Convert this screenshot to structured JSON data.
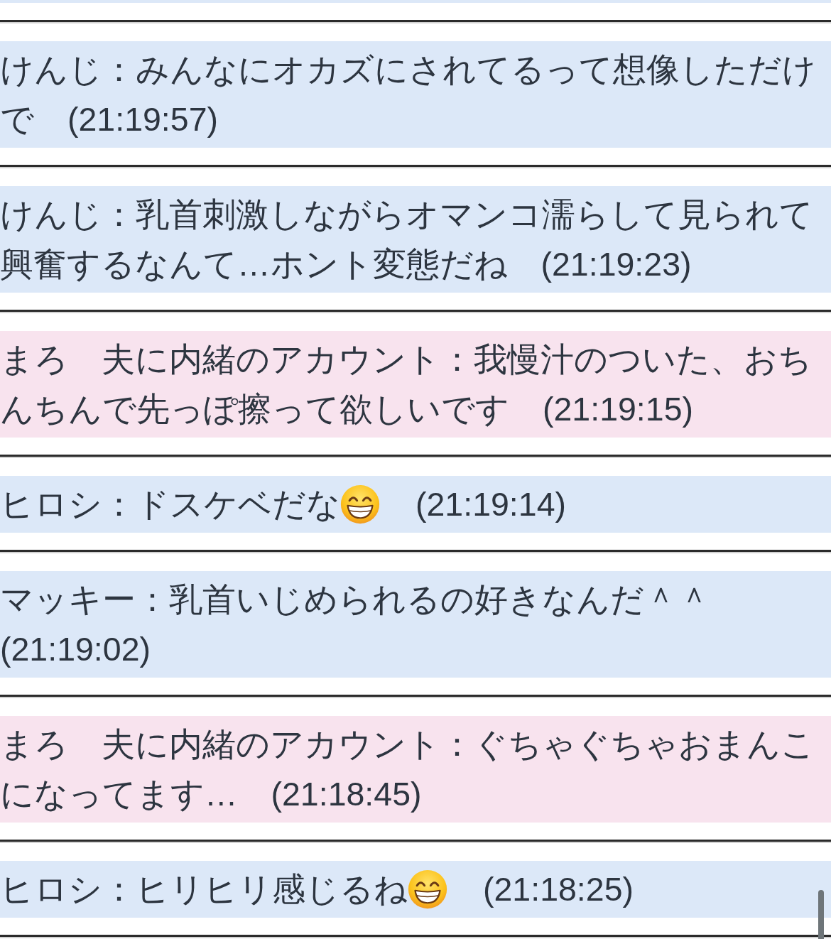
{
  "previous_message": {
    "color": "#dce8f8"
  },
  "messages": [
    {
      "kind": "plain",
      "color": "#dce8f8",
      "text": "けんじ：みんなにオカズにされてるって想像しただけで　(21:19:57)"
    },
    {
      "kind": "plain",
      "color": "#dce8f8",
      "text": "けんじ：乳首刺激しながらオマンコ濡らして見られて興奮するなんて…ホント変態だね　(21:19:23)"
    },
    {
      "kind": "plain",
      "color": "#f8e3ee",
      "text": "まろ　夫に内緒のアカウント：我慢汁のついた、おちんちんで先っぽ擦って欲しいです　(21:19:15)"
    },
    {
      "kind": "emoji",
      "color": "#dce8f8",
      "text": "ヒロシ：ドスケベだな",
      "time": "(21:19:14)"
    },
    {
      "kind": "plain",
      "color": "#dce8f8",
      "text": "マッキー：乳首いじめられるの好きなんだ＾＾　(21:19:02)"
    },
    {
      "kind": "plain",
      "color": "#f8e3ee",
      "text": "まろ　夫に内緒のアカウント：ぐちゃぐちゃおまんこになってます…　(21:18:45)"
    },
    {
      "kind": "emoji",
      "color": "#dce8f8",
      "text": "ヒロシ：ヒリヒリ感じるね",
      "time": "(21:18:25)"
    }
  ]
}
